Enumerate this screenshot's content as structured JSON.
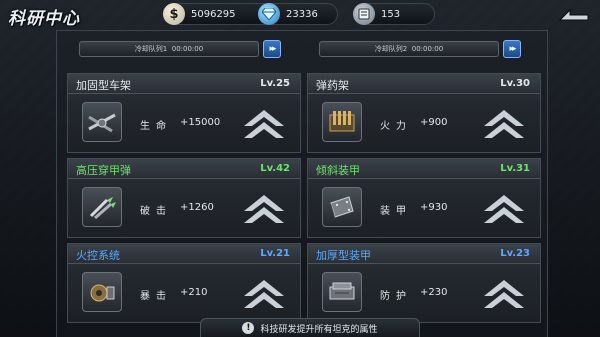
{
  "header": {
    "title": "科研中心"
  },
  "resources": {
    "gold": {
      "icon": "$",
      "value": "5096295"
    },
    "diamond": {
      "value": "23336"
    },
    "book": {
      "value": "153"
    }
  },
  "queues": [
    {
      "label": "冷却队列1",
      "time": "00:00:00"
    },
    {
      "label": "冷却队列2",
      "time": "00:00:00"
    }
  ],
  "cards": [
    {
      "name": "加固型车架",
      "level": "Lv.25",
      "stat_label": "生命",
      "stat_value": "+15000",
      "icon": "chassis-icon",
      "color": "#e4e7ea"
    },
    {
      "name": "弹药架",
      "level": "Lv.30",
      "stat_label": "火力",
      "stat_value": "+900",
      "icon": "ammo-rack-icon",
      "color": "#e4e7ea"
    },
    {
      "name": "高压穿甲弹",
      "level": "Lv.42",
      "stat_label": "破击",
      "stat_value": "+1260",
      "icon": "ap-shell-icon",
      "color": "#6fe36a"
    },
    {
      "name": "倾斜装甲",
      "level": "Lv.31",
      "stat_label": "装甲",
      "stat_value": "+930",
      "icon": "sloped-armor-icon",
      "color": "#6fe36a"
    },
    {
      "name": "火控系统",
      "level": "Lv.21",
      "stat_label": "暴击",
      "stat_value": "+210",
      "icon": "fire-control-icon",
      "color": "#58a9ff"
    },
    {
      "name": "加厚型装甲",
      "level": "Lv.23",
      "stat_label": "防护",
      "stat_value": "+230",
      "icon": "thick-armor-icon",
      "color": "#58a9ff"
    }
  ],
  "footer": {
    "warn_icon": "!",
    "tip": "科技研发提升所有坦克的属性"
  }
}
